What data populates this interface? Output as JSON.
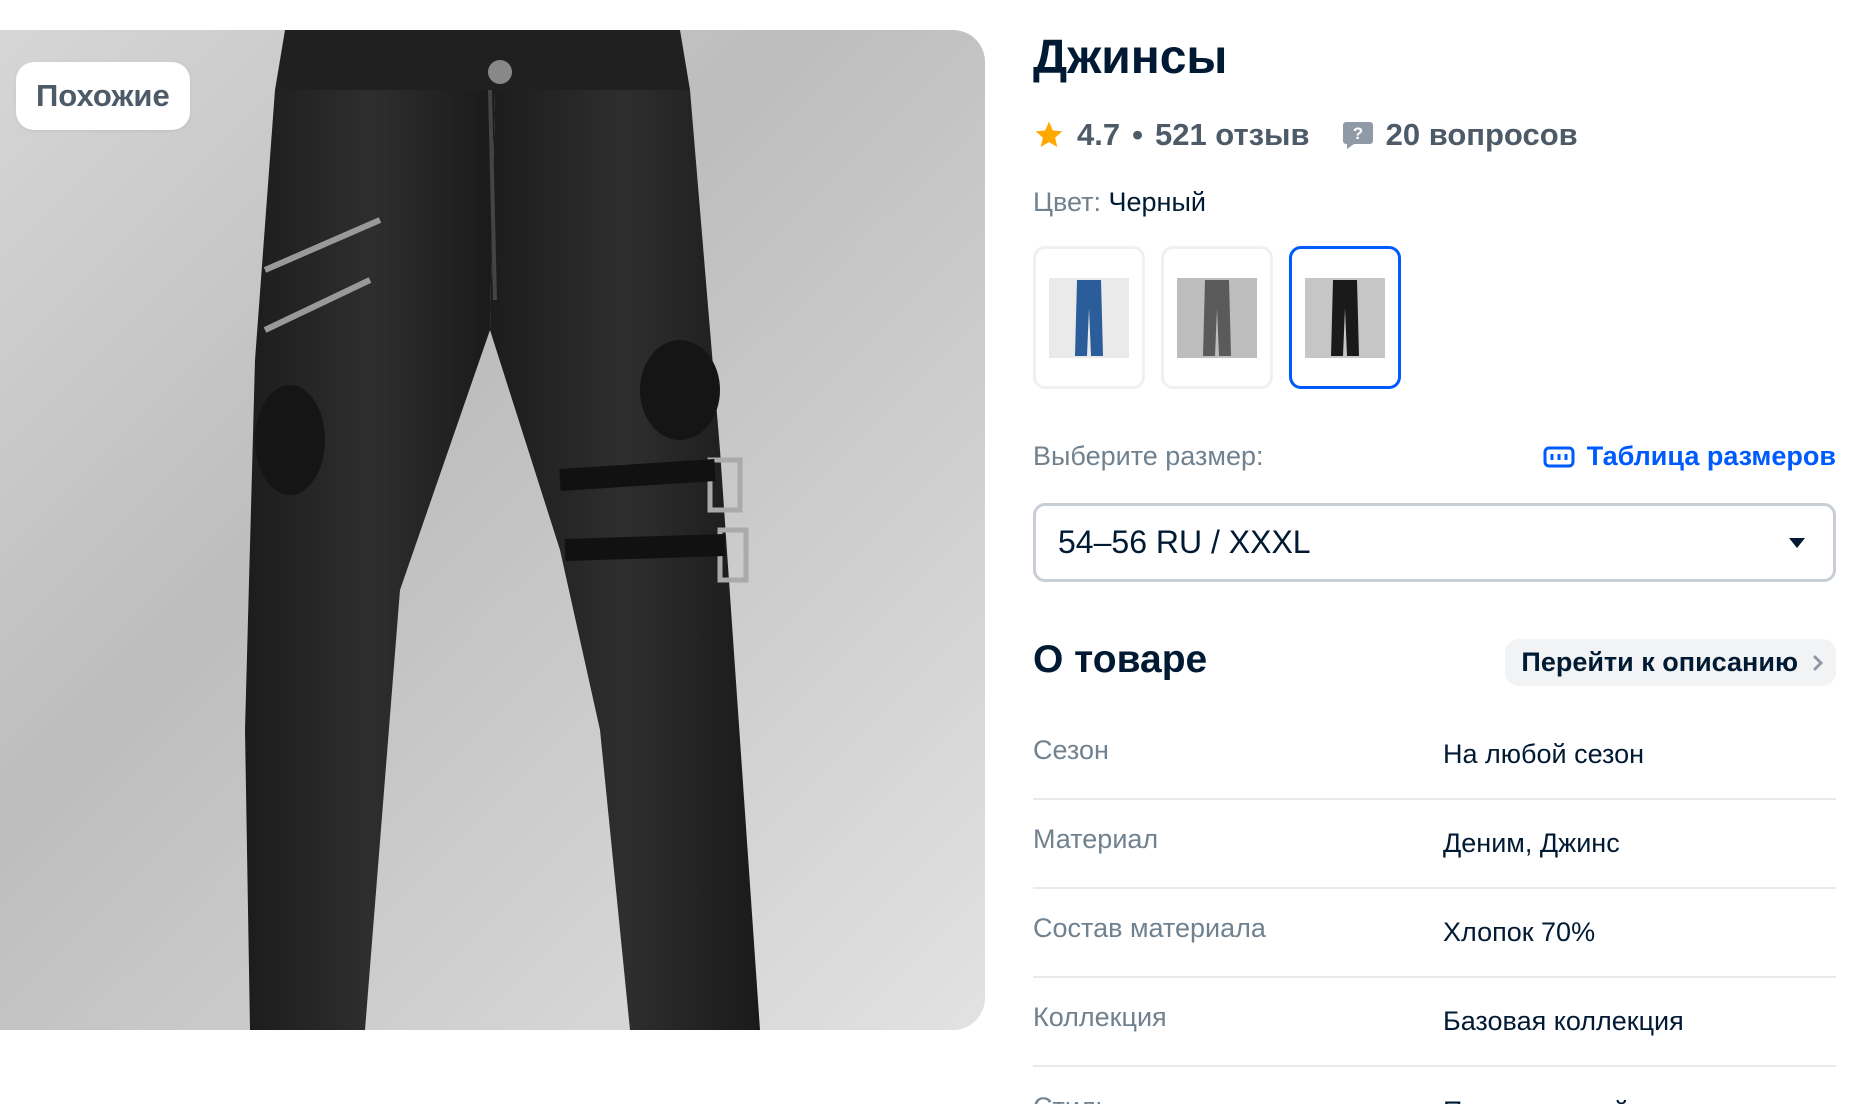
{
  "gallery": {
    "similar_label": "Похожие"
  },
  "product": {
    "title": "Джинсы",
    "rating": "4.7",
    "bullet": "•",
    "reviews": "521 отзыв",
    "questions": "20 вопросов"
  },
  "color": {
    "label": "Цвет:",
    "value": "Черный",
    "swatches": [
      {
        "name": "blue",
        "color": "#2a5d9a",
        "active": false
      },
      {
        "name": "gray",
        "color": "#5a5a5a",
        "active": false
      },
      {
        "name": "black",
        "color": "#1a1a1a",
        "active": true
      }
    ]
  },
  "size": {
    "label": "Выберите размер:",
    "table_link": "Таблица размеров",
    "selected": "54–56 RU / XXXL"
  },
  "about": {
    "title": "О товаре",
    "to_description": "Перейти к описанию",
    "properties": [
      {
        "name": "Сезон",
        "value": "На любой сезон"
      },
      {
        "name": "Материал",
        "value": "Деним, Джинс"
      },
      {
        "name": "Состав материала",
        "value": "Хлопок 70%"
      },
      {
        "name": "Коллекция",
        "value": "Базовая коллекция"
      },
      {
        "name": "Стиль",
        "value": "Повседневный"
      }
    ]
  },
  "colors": {
    "accent": "#005bff",
    "star": "#ffa800",
    "muted": "#70818f",
    "text": "#001a34"
  }
}
